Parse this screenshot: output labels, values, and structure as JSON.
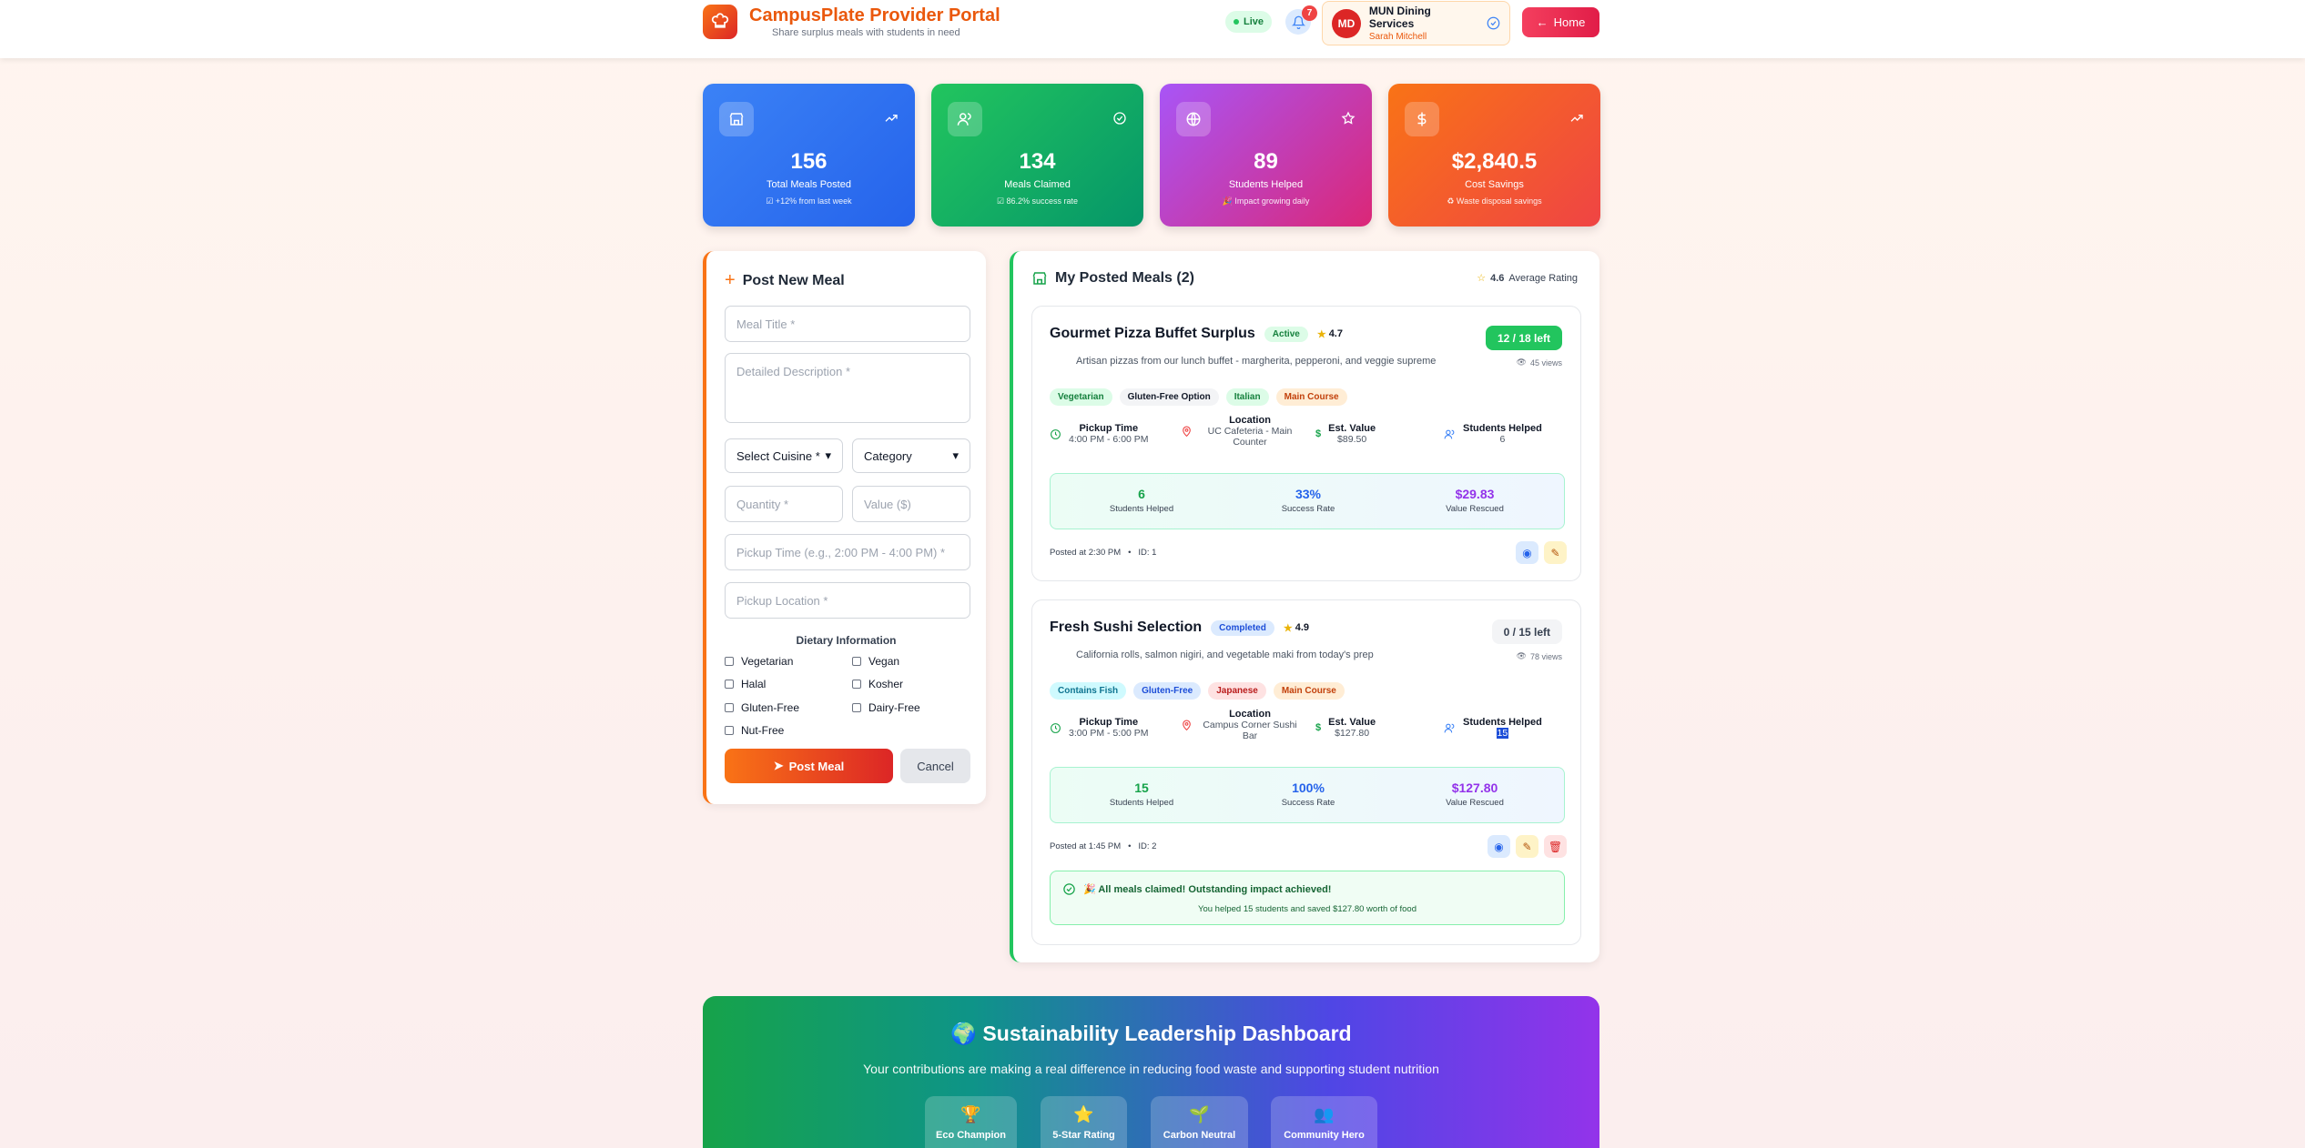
{
  "header": {
    "brand": "CampusPlate Provider Portal",
    "tagline": "Share surplus meals with students in need",
    "live": "Live",
    "notifications": "7",
    "user_initials": "MD",
    "user_org": "MUN Dining Services",
    "user_name": "Sarah Mitchell",
    "home": "Home"
  },
  "stats": [
    {
      "value": "156",
      "label": "Total Meals Posted",
      "sub": "+12% from last week",
      "color": "#3b82f6"
    },
    {
      "value": "134",
      "label": "Meals Claimed",
      "sub": "86.2% success rate",
      "color": "#10b981"
    },
    {
      "value": "89",
      "label": "Students Helped",
      "sub": "Impact growing daily",
      "color": "#a855f7"
    },
    {
      "value": "$2,840.5",
      "label": "Cost Savings",
      "sub": "Waste disposal savings",
      "color": "#f97316"
    }
  ],
  "form": {
    "title": "Post New Meal",
    "meal_title": "Meal Title *",
    "description": "Detailed Description *",
    "cuisine": "Select Cuisine *",
    "category": "Category",
    "quantity": "Quantity *",
    "value": "Value ($)",
    "pickup_time": "Pickup Time (e.g., 2:00 PM - 4:00 PM) *",
    "pickup_location": "Pickup Location *",
    "dietary_title": "Dietary Information",
    "dietary": [
      "Vegetarian",
      "Vegan",
      "Halal",
      "Kosher",
      "Gluten-Free",
      "Dairy-Free",
      "Nut-Free"
    ],
    "post": "Post Meal",
    "cancel": "Cancel"
  },
  "meals_panel": {
    "title": "My Posted Meals (2)",
    "avg_rating": "4.6",
    "avg_label": "Average Rating"
  },
  "meals": [
    {
      "title": "Gourmet Pizza Buffet Surplus",
      "status": "Active",
      "rating": "4.7",
      "description": "Artisan pizzas from our lunch buffet - margherita, pepperoni, and veggie supreme",
      "left": "12 / 18 left",
      "views": "45 views",
      "tags": [
        "Vegetarian",
        "Gluten-Free Option",
        "Italian",
        "Main Course"
      ],
      "pickup_label": "Pickup Time",
      "pickup_time": "4:00 PM - 6:00 PM",
      "location_label": "Location",
      "location": "UC Cafeteria - Main Counter",
      "value_label": "Est. Value",
      "value": "$89.50",
      "helped_label": "Students Helped",
      "helped": "6",
      "m_helped": "6",
      "m_helped_label": "Students Helped",
      "m_rate": "33%",
      "m_rate_label": "Success Rate",
      "m_value": "$29.83",
      "m_value_label": "Value Rescued",
      "posted": "Posted at 2:30 PM",
      "id": "ID: 1"
    },
    {
      "title": "Fresh Sushi Selection",
      "status": "Completed",
      "rating": "4.9",
      "description": "California rolls, salmon nigiri, and vegetable maki from today's prep",
      "left": "0 / 15 left",
      "views": "78 views",
      "tags": [
        "Contains Fish",
        "Gluten-Free",
        "Japanese",
        "Main Course"
      ],
      "pickup_label": "Pickup Time",
      "pickup_time": "3:00 PM - 5:00 PM",
      "location_label": "Location",
      "location": "Campus Corner Sushi Bar",
      "value_label": "Est. Value",
      "value": "$127.80",
      "helped_label": "Students Helped",
      "helped": "15",
      "m_helped": "15",
      "m_helped_label": "Students Helped",
      "m_rate": "100%",
      "m_rate_label": "Success Rate",
      "m_value": "$127.80",
      "m_value_label": "Value Rescued",
      "posted": "Posted at 1:45 PM",
      "id": "ID: 2",
      "done_title": "🎉 All meals claimed! Outstanding impact achieved!",
      "done_sub": "You helped 15 students and saved $127.80 worth of food"
    }
  ],
  "banner": {
    "title": "🌍 Sustainability Leadership Dashboard",
    "subtitle": "Your contributions are making a real difference in reducing food waste and supporting student nutrition",
    "badges": [
      {
        "emoji": "🏆",
        "label": "Eco Champion"
      },
      {
        "emoji": "⭐",
        "label": "5-Star Rating"
      },
      {
        "emoji": "🌱",
        "label": "Carbon Neutral"
      },
      {
        "emoji": "👥",
        "label": "Community Hero"
      }
    ]
  }
}
